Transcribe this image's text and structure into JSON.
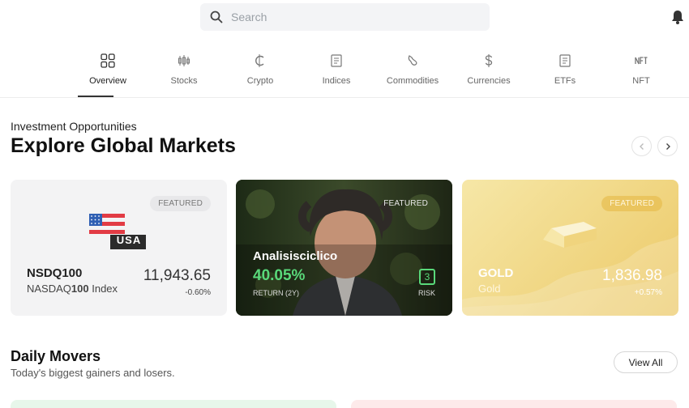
{
  "search": {
    "placeholder": "Search"
  },
  "tabs": [
    {
      "label": "Overview",
      "icon": "grid-icon"
    },
    {
      "label": "Stocks",
      "icon": "candlestick-icon"
    },
    {
      "label": "Crypto",
      "icon": "crypto-icon"
    },
    {
      "label": "Indices",
      "icon": "document-icon"
    },
    {
      "label": "Commodities",
      "icon": "drop-icon"
    },
    {
      "label": "Currencies",
      "icon": "dollar-icon"
    },
    {
      "label": "ETFs",
      "icon": "document-icon"
    },
    {
      "label": "NFT",
      "icon": "nft-icon"
    }
  ],
  "section": {
    "subtitle": "Investment Opportunities",
    "title": "Explore Global Markets"
  },
  "cards": {
    "nsdq": {
      "badge": "FEATURED",
      "flag_label": "USA",
      "symbol": "NSDQ100",
      "name_prefix": "NASDAQ",
      "name_bold": "100",
      "name_suffix": " Index",
      "price": "11,943.65",
      "change": "-0.60%"
    },
    "analyst": {
      "badge": "FEATURED",
      "name": "Analisisciclico",
      "return": "40.05%",
      "return_label": "RETURN (2Y)",
      "risk": "3",
      "risk_label": "RISK"
    },
    "gold": {
      "badge": "FEATURED",
      "symbol": "GOLD",
      "name": "Gold",
      "price": "1,836.98",
      "change": "+0.57%"
    }
  },
  "movers": {
    "title": "Daily Movers",
    "subtitle": "Today's biggest gainers and losers.",
    "view_all": "View All"
  },
  "colors": {
    "positive": "#59d97a",
    "gold_light": "#f6e7a7",
    "gold_dark": "#ecc967"
  }
}
